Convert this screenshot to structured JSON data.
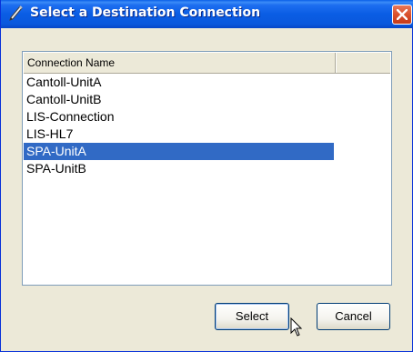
{
  "window": {
    "title": "Select a Destination Connection"
  },
  "list": {
    "columns": [
      "Connection Name",
      ""
    ],
    "items": [
      {
        "label": "Cantoll-UnitA",
        "selected": false
      },
      {
        "label": "Cantoll-UnitB",
        "selected": false
      },
      {
        "label": "LIS-Connection",
        "selected": false
      },
      {
        "label": "LIS-HL7",
        "selected": false
      },
      {
        "label": "SPA-UnitA",
        "selected": true
      },
      {
        "label": "SPA-UnitB",
        "selected": false
      }
    ]
  },
  "buttons": {
    "select_label": "Select",
    "cancel_label": "Cancel"
  },
  "colors": {
    "titlebar": "#0a58dd",
    "selection": "#316ac5",
    "close": "#d9512d"
  }
}
